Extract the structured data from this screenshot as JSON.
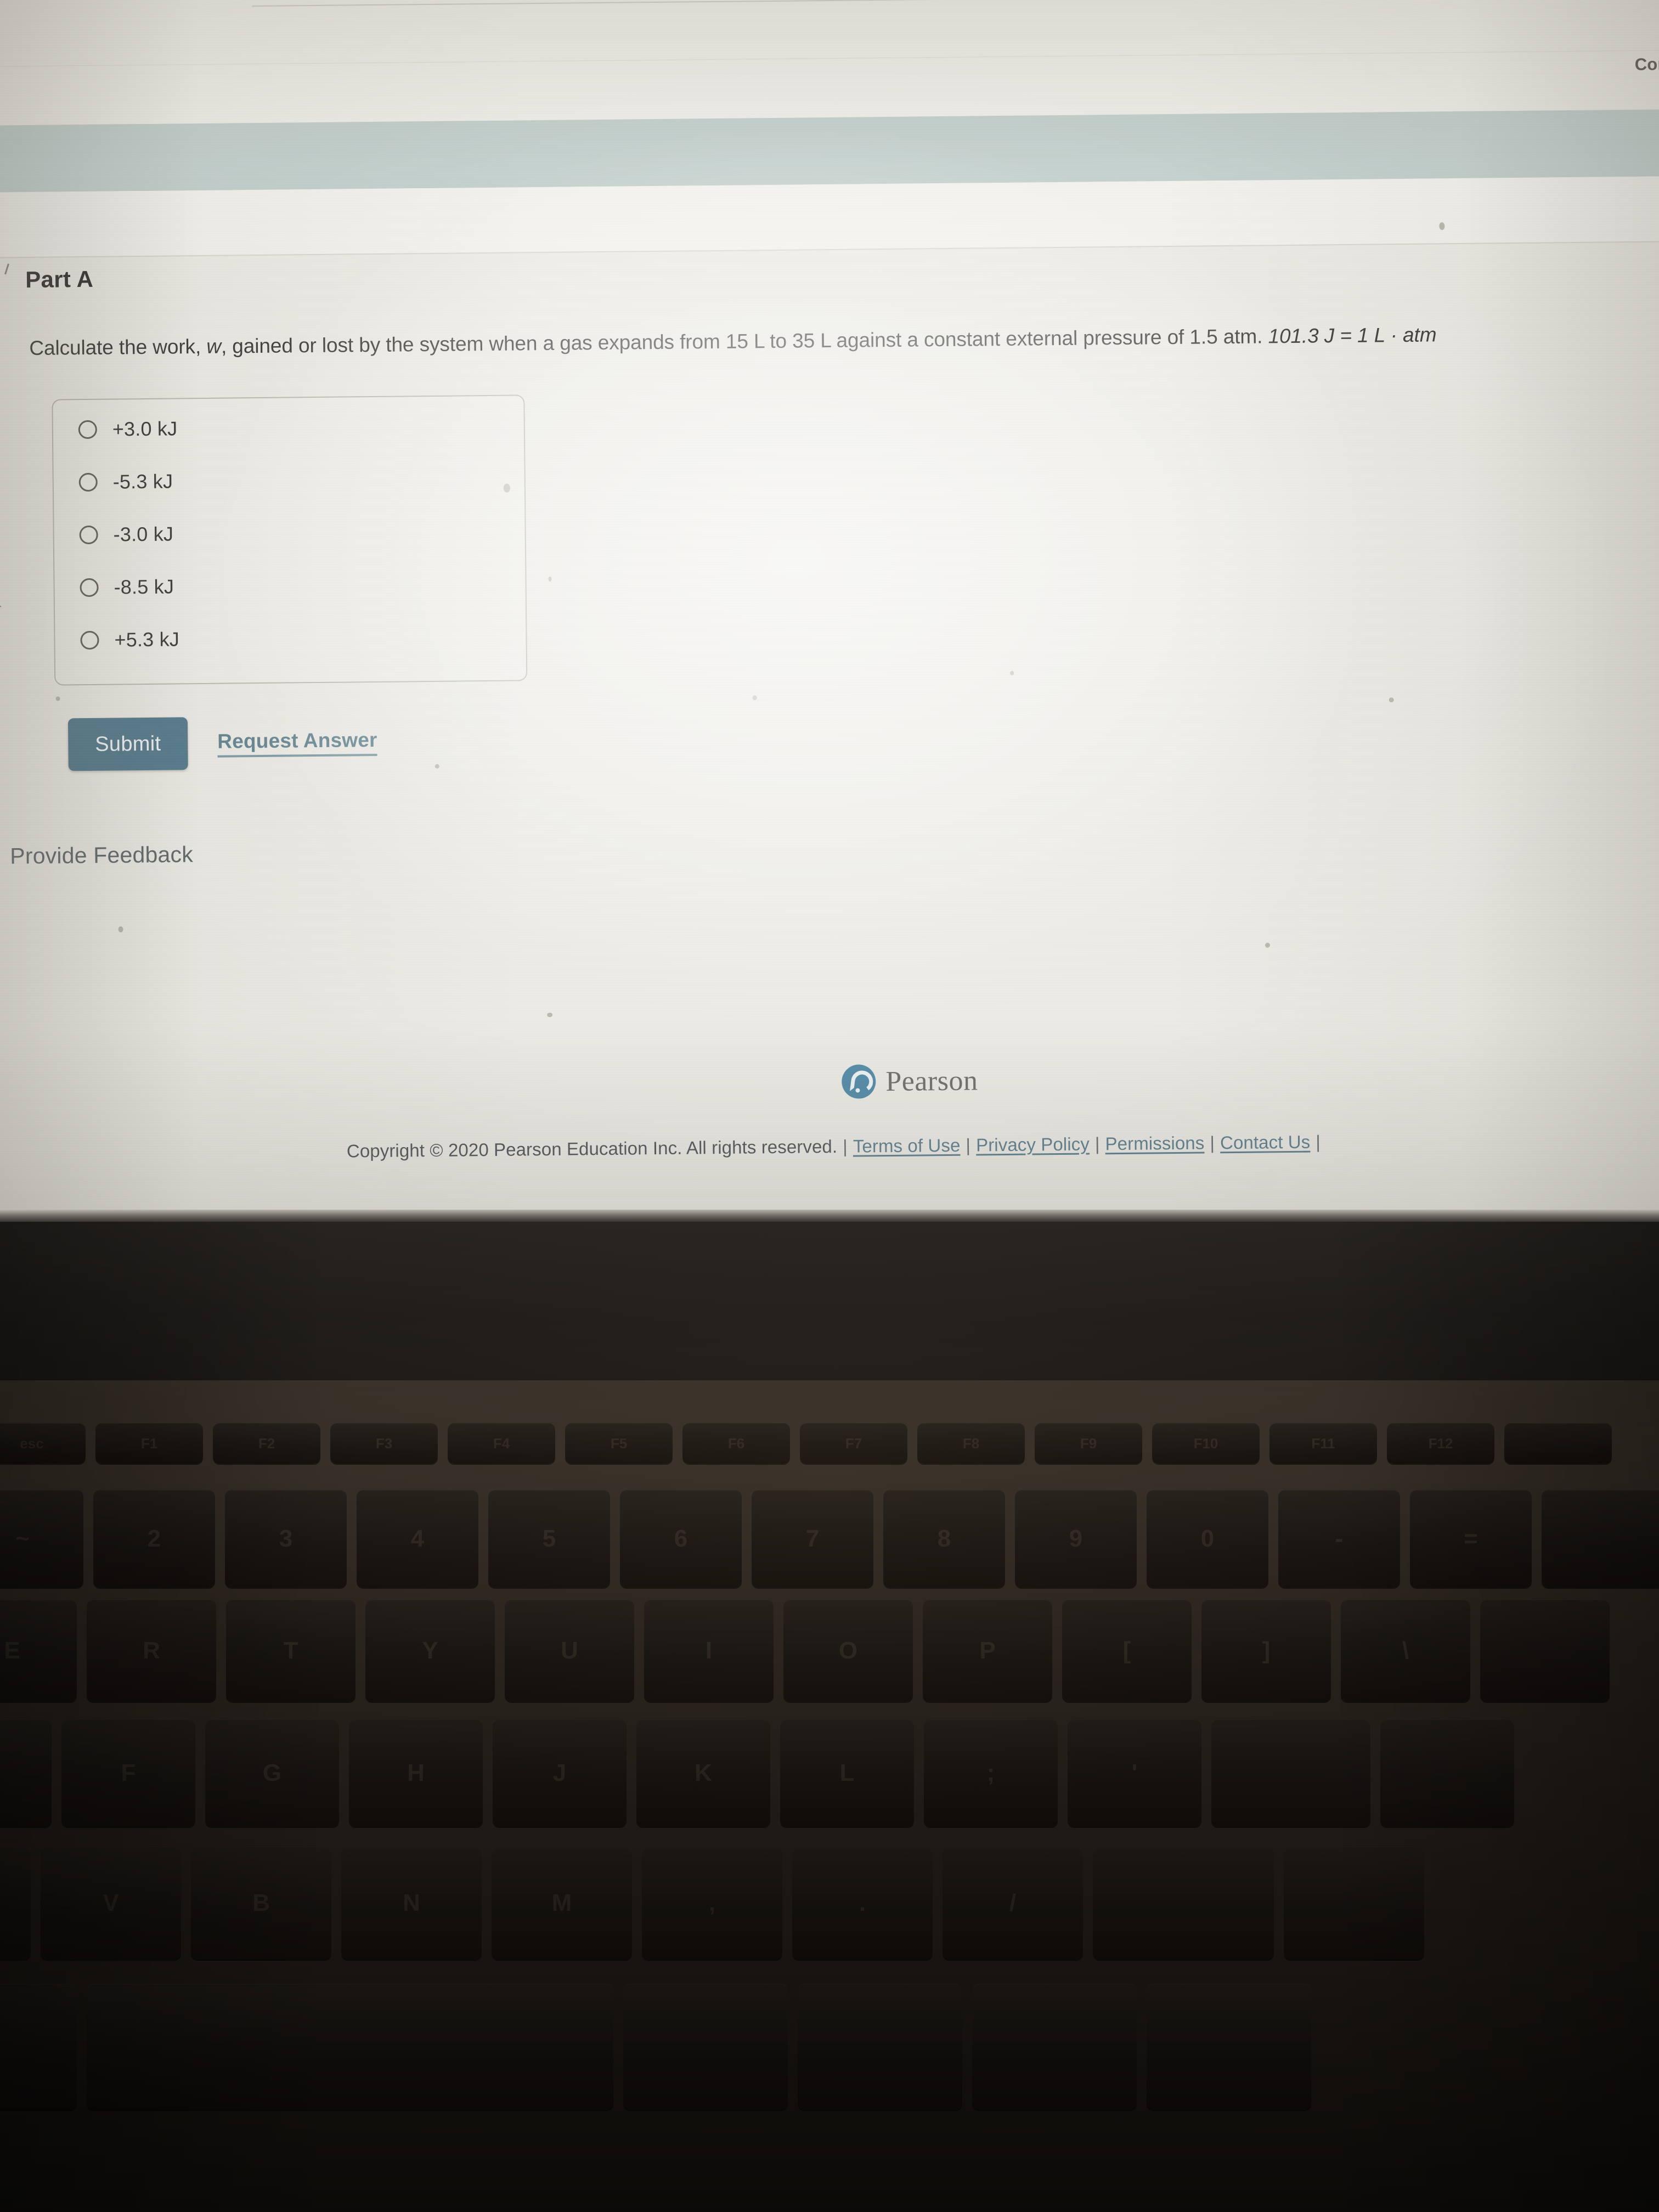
{
  "top_chrome": {
    "cut_off_label": "Con"
  },
  "part": {
    "collapse_icon": "caret-down-icon",
    "title": "Part A",
    "question_prefix": "Calculate the work, ",
    "question_var": "w",
    "question_middle": ", gained or lost by the system when a gas expands from 15 L to 35 L against a constant external pressure of 1.5 atm. ",
    "question_conversion": "101.3 J = 1 L · atm",
    "question_full": "Calculate the work, w, gained or lost by the system when a gas expands from 15 L to 35 L against a constant external pressure of 1.5 atm. 101.3 J = 1 L · atm"
  },
  "choices": [
    {
      "label": "+3.0 kJ",
      "selected": false
    },
    {
      "label": "-5.3 kJ",
      "selected": false
    },
    {
      "label": "-3.0 kJ",
      "selected": false
    },
    {
      "label": "-8.5 kJ",
      "selected": false
    },
    {
      "label": "+5.3 kJ",
      "selected": false
    }
  ],
  "actions": {
    "submit_label": "Submit",
    "request_answer_label": "Request Answer",
    "submit_color": "#4e7587",
    "link_color": "#5d7f8c"
  },
  "feedback": {
    "label": "Provide Feedback"
  },
  "branding": {
    "logo_icon": "pearson-p-icon",
    "wordmark": "Pearson",
    "logo_color": "#4d87a5"
  },
  "footer": {
    "copyright": "Copyright © 2020 Pearson Education Inc. All rights reserved.",
    "separator": "|",
    "links": [
      "Terms of Use",
      "Privacy Policy",
      "Permissions",
      "Contact Us"
    ],
    "trailing_separator": "|"
  },
  "pointer": {
    "cursor_icon": "mouse-arrow-cursor"
  }
}
